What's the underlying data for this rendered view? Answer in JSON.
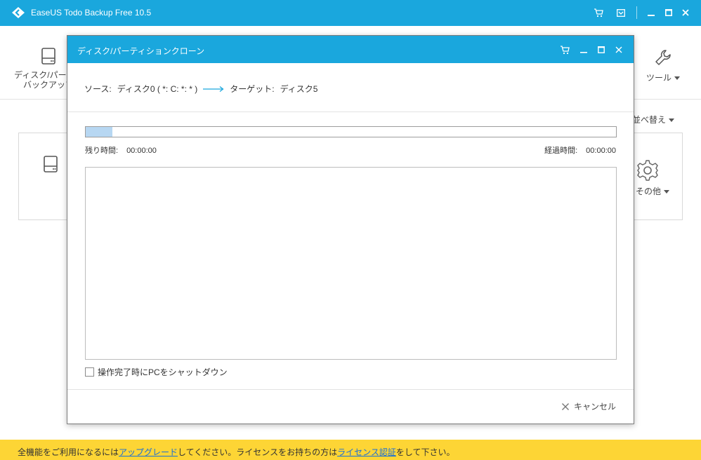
{
  "app": {
    "title": "EaseUS Todo Backup Free 10.5",
    "accent_color": "#1aa7dd",
    "icons": [
      "logo-icon",
      "cart-icon",
      "dropdown-box-icon",
      "minimize-icon",
      "maximize-icon",
      "close-icon"
    ]
  },
  "toolbar": {
    "disk_label_line1": "ディスク/パーティ",
    "disk_label_line2": "バックアップ",
    "tools_label": "ツール"
  },
  "content": {
    "sort_label": "並べ替え",
    "other_label": "その他"
  },
  "dialog": {
    "title": "ディスク/パーティションクローン",
    "source_label": "ソース:",
    "source_value": "ディスク0 ( *: C: *: * )",
    "target_label": "ターゲット:",
    "target_value": "ディスク5",
    "progress_fraction": 0.05,
    "remaining_label": "残り時間:",
    "remaining_value": "00:00:00",
    "elapsed_label": "経過時間:",
    "elapsed_value": "00:00:00",
    "shutdown_label": "操作完了時にPCをシャットダウン",
    "shutdown_checked": false,
    "cancel_label": "キャンセル"
  },
  "notice": {
    "text_1": "全機能をご利用になるには",
    "link_upgrade": "アップグレード",
    "text_2": "してください。ライセンスをお持ちの方は",
    "link_license": "ライセンス認証",
    "text_3": "をして下さい。",
    "bg_color": "#fdd535"
  }
}
